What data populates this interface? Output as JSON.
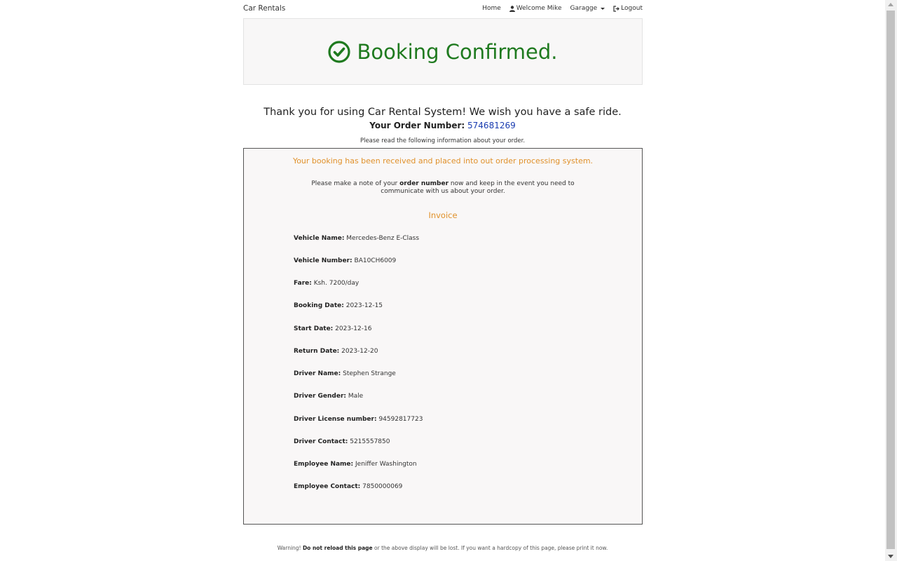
{
  "navbar": {
    "brand": "Car Rentals",
    "home": "Home",
    "welcome": "Welcome Mike",
    "garage": "Garagge",
    "logout": "Logout"
  },
  "header": {
    "title": "Booking Confirmed.",
    "color": "#1f7a1f"
  },
  "thanks": "Thank you for using Car Rental System! We wish you have a safe ride.",
  "order": {
    "label": "Your Order Number:",
    "number": "574681269"
  },
  "read_info": "Please read the following information about your order.",
  "invoice": {
    "received_msg": "Your booking has been received and placed into out order processing system.",
    "note_pre": "Please make a note of your ",
    "note_bold": "order number",
    "note_post": " now and keep in the event you need to communicate with us about your order.",
    "title": "Invoice",
    "accent": "#e0912b",
    "fields": [
      {
        "label": "Vehicle Name:",
        "value": "Mercedes-Benz E-Class"
      },
      {
        "label": "Vehicle Number:",
        "value": "BA10CH6009"
      },
      {
        "label": "Fare:",
        "value": "Ksh. 7200/day"
      },
      {
        "label": "Booking Date:",
        "value": "2023-12-15"
      },
      {
        "label": "Start Date:",
        "value": "2023-12-16"
      },
      {
        "label": "Return Date:",
        "value": "2023-12-20"
      },
      {
        "label": "Driver Name:",
        "value": "Stephen Strange"
      },
      {
        "label": "Driver Gender:",
        "value": "Male"
      },
      {
        "label": "Driver License number:",
        "value": "94592817723"
      },
      {
        "label": "Driver Contact:",
        "value": "5215557850"
      },
      {
        "label": "Employee Name:",
        "value": "Jeniffer Washington"
      },
      {
        "label": "Employee Contact:",
        "value": "7850000069"
      }
    ]
  },
  "footer": {
    "pre": "Warning! ",
    "bold": "Do not reload this page",
    "post": " or the above display will be lost. If you want a hardcopy of this page, please print it now."
  },
  "icons": {
    "check": "check-circle-icon",
    "user": "user-icon",
    "logout": "logout-icon",
    "dropdown": "caret-down-icon"
  }
}
